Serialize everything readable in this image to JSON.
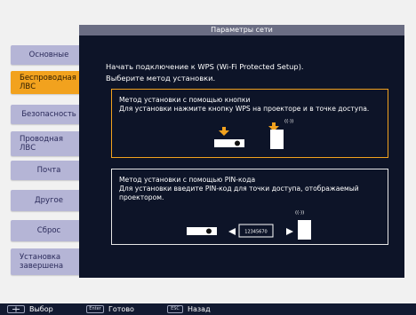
{
  "header": {
    "title": "Параметры сети"
  },
  "sidebar": {
    "items": [
      {
        "label": "Основные",
        "active": false
      },
      {
        "label": "Беспроводная ЛВС",
        "active": true
      },
      {
        "label": "Безопасность",
        "active": false
      },
      {
        "label": "Проводная ЛВС",
        "active": false
      },
      {
        "label": "Почта",
        "active": false
      },
      {
        "label": "Другое",
        "active": false
      },
      {
        "label": "Сброс",
        "active": false
      },
      {
        "label": "Установка завершена",
        "active": false
      }
    ]
  },
  "main": {
    "intro_line1": "Начать подключение к WPS (Wi-Fi Protected Setup).",
    "intro_line2": "Выберите метод установки.",
    "option_button": {
      "title": "Метод установки с помощью кнопки",
      "desc": "Для установки нажмите кнопку WPS на проекторе и в точке доступа."
    },
    "option_pin": {
      "title": "Метод установки с помощью PIN-кода",
      "desc": "Для установки введите PIN-код для точки доступа, отображаемый проектором.",
      "pin_code": "12345670"
    },
    "wireless_symbol": "((·))"
  },
  "footer": {
    "select_label": "Выбор",
    "enter_key": "Enter",
    "enter_label": "Готово",
    "esc_key": "ESC",
    "esc_label": "Назад"
  },
  "colors": {
    "accent": "#f2a21e",
    "menu_item": "#b5b5d6",
    "panel_bg": "#0d1428",
    "header_bg": "#6a6d83"
  }
}
